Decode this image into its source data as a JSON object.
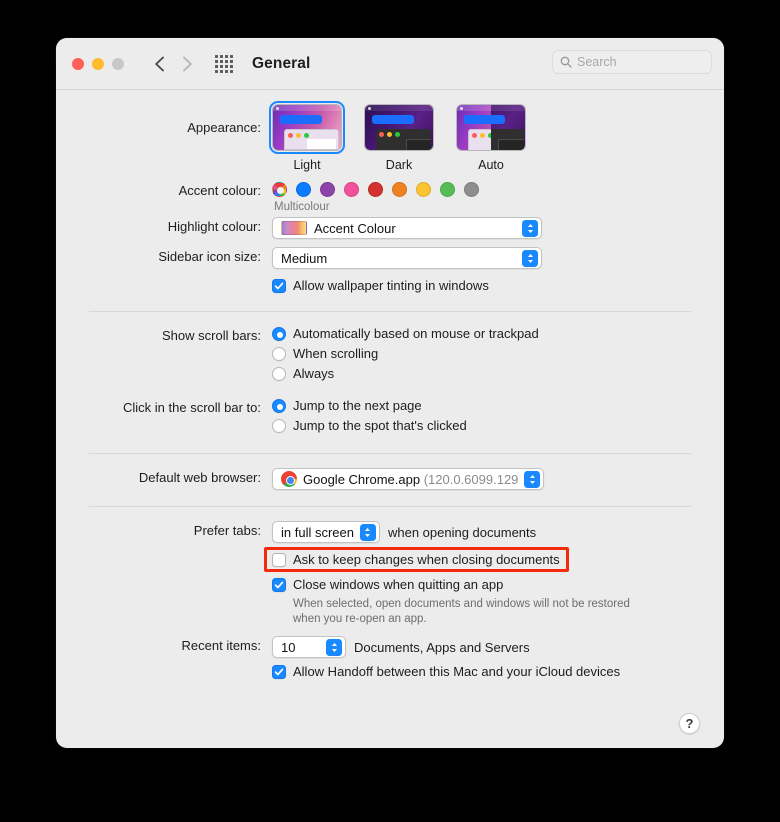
{
  "window": {
    "title": "General",
    "traffic_lights": [
      "close-red",
      "minimize-yellow",
      "zoom-grey-disabled"
    ],
    "back_icon": "chevron-left-icon",
    "forward_icon": "chevron-right-icon",
    "grid_icon": "grid-apps-icon",
    "search": {
      "placeholder": "Search",
      "value": "",
      "icon": "search-icon"
    },
    "help_label": "?"
  },
  "appearance": {
    "label": "Appearance:",
    "selected": "Light",
    "options": [
      {
        "name": "Light",
        "caption": "Light"
      },
      {
        "name": "Dark",
        "caption": "Dark"
      },
      {
        "name": "Auto",
        "caption": "Auto"
      }
    ]
  },
  "accent": {
    "label": "Accent colour:",
    "selected": "Multicolour",
    "caption": "Multicolour",
    "swatches": [
      {
        "name": "Multicolour",
        "hex": "multicolour"
      },
      {
        "name": "Blue",
        "hex": "#0a7cff"
      },
      {
        "name": "Purple",
        "hex": "#8d43a8"
      },
      {
        "name": "Pink",
        "hex": "#f2519b"
      },
      {
        "name": "Red",
        "hex": "#d3322f"
      },
      {
        "name": "Orange",
        "hex": "#ef8323"
      },
      {
        "name": "Yellow",
        "hex": "#fcc433"
      },
      {
        "name": "Green",
        "hex": "#56bd56"
      },
      {
        "name": "Graphite",
        "hex": "#8e8e8e"
      }
    ]
  },
  "highlight_colour": {
    "label": "Highlight colour:",
    "value": "Accent Colour",
    "swatch": "gradient-accent"
  },
  "sidebar_icon_size": {
    "label": "Sidebar icon size:",
    "value": "Medium"
  },
  "wallpaper_tinting": {
    "label": "Allow wallpaper tinting in windows",
    "checked": true
  },
  "scroll_bars": {
    "label": "Show scroll bars:",
    "options": [
      {
        "label": "Automatically based on mouse or trackpad",
        "selected": true
      },
      {
        "label": "When scrolling",
        "selected": false
      },
      {
        "label": "Always",
        "selected": false
      }
    ]
  },
  "scroll_click": {
    "label": "Click in the scroll bar to:",
    "options": [
      {
        "label": "Jump to the next page",
        "selected": true
      },
      {
        "label": "Jump to the spot that's clicked",
        "selected": false
      }
    ]
  },
  "default_browser": {
    "label": "Default web browser:",
    "value": "Google Chrome.app",
    "version": "(120.0.6099.129)",
    "icon": "chrome-icon"
  },
  "prefer_tabs": {
    "label": "Prefer tabs:",
    "value": "in full screen",
    "suffix": "when opening documents"
  },
  "ask_keep_changes": {
    "label": "Ask to keep changes when closing documents",
    "checked": false,
    "highlighted": true,
    "highlight_color": "#f52a0c"
  },
  "close_windows": {
    "label": "Close windows when quitting an app",
    "checked": true,
    "help": "When selected, open documents and windows will not be restored when you re-open an app."
  },
  "recent_items": {
    "label": "Recent items:",
    "value": "10",
    "suffix": "Documents, Apps and Servers"
  },
  "handoff": {
    "label": "Allow Handoff between this Mac and your iCloud devices",
    "checked": true
  }
}
